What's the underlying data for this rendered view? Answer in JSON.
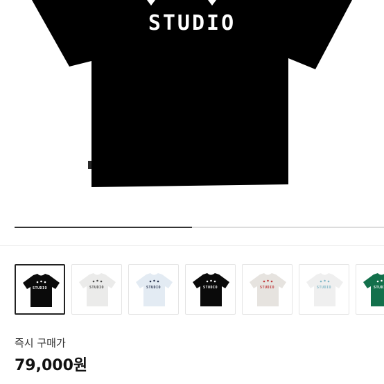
{
  "hero": {
    "print_text": "STUDIO",
    "shirt_color": "#000000",
    "print_color": "#ffffff"
  },
  "gallery": {
    "progress_fraction": 0.48,
    "selected_index": 0,
    "thumbnails": [
      {
        "shirt": "#0a0a0a",
        "print": "#ffffff",
        "text": "STUDIO"
      },
      {
        "shirt": "#ebebea",
        "print": "#4a4a4a",
        "text": "STUDIO"
      },
      {
        "shirt": "#e3ebf3",
        "print": "#2b3550",
        "text": "STUDIO"
      },
      {
        "shirt": "#0a0a0a",
        "print": "#ffffff",
        "text": "STUDIO"
      },
      {
        "shirt": "#e6e3df",
        "print": "#c0393b",
        "text": "STUDIO"
      },
      {
        "shirt": "#efefef",
        "print": "#7fb7c7",
        "text": "STUDIO"
      },
      {
        "shirt": "#12704b",
        "print": "#ffffff",
        "text": "STUDIO"
      }
    ]
  },
  "price": {
    "label": "즉시 구매가",
    "value": "79,000원"
  }
}
